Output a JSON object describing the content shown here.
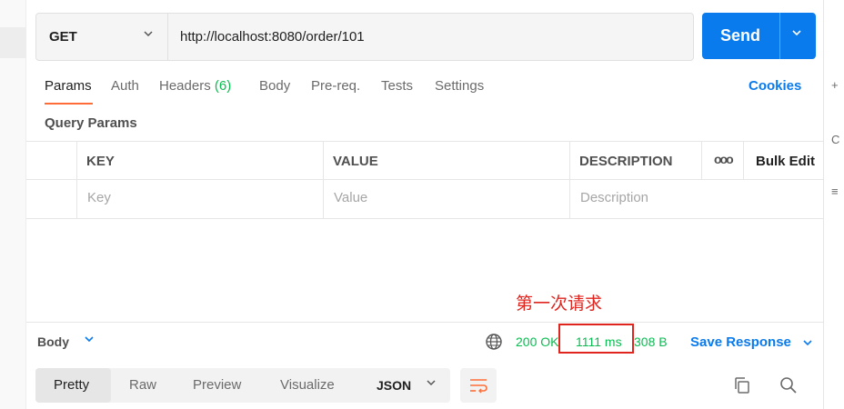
{
  "request": {
    "method": "GET",
    "url": "http://localhost:8080/order/101",
    "send_label": "Send"
  },
  "tabs": [
    {
      "label": "Params",
      "active": true
    },
    {
      "label": "Auth"
    },
    {
      "label": "Headers",
      "count": "(6)"
    },
    {
      "label": "Body"
    },
    {
      "label": "Pre-req."
    },
    {
      "label": "Tests"
    },
    {
      "label": "Settings"
    }
  ],
  "cookies_label": "Cookies",
  "query_params": {
    "title": "Query Params",
    "columns": [
      "KEY",
      "VALUE",
      "DESCRIPTION"
    ],
    "bulk_edit_label": "Bulk Edit",
    "more_label": "ooo",
    "placeholders": [
      "Key",
      "Value",
      "Description"
    ]
  },
  "annotation": {
    "text": "第一次请求",
    "color": "#e0251f"
  },
  "response": {
    "body_label": "Body",
    "status": "200 OK",
    "time": "1111 ms",
    "size": "308 B",
    "save_label": "Save Response",
    "view_options": [
      "Pretty",
      "Raw",
      "Preview",
      "Visualize"
    ],
    "active_view": "Pretty",
    "format": "JSON"
  },
  "colors": {
    "accent": "#097bed",
    "success": "#0cbb52",
    "tab_underline": "#ff6c37"
  },
  "right_gutter_glyphs": [
    "+",
    "C",
    "≡"
  ]
}
